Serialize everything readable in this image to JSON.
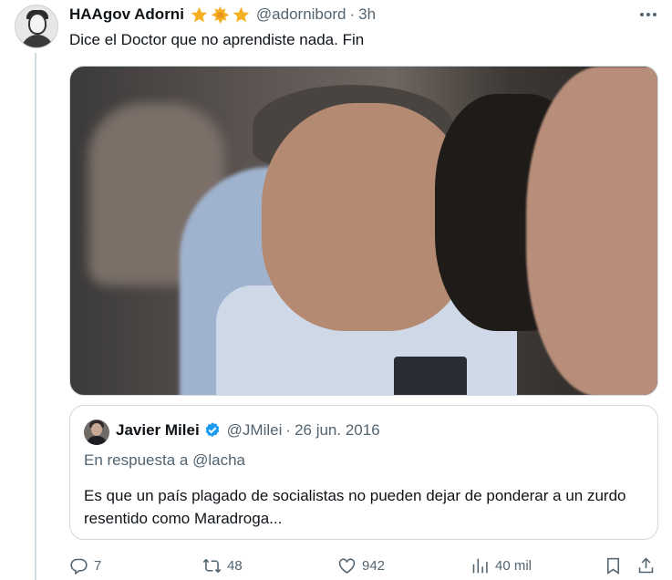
{
  "tweet": {
    "author_name": "HAAgov Adorni",
    "handle": "@adornibord",
    "separator": "·",
    "time": "3h",
    "text": "Dice el Doctor que no aprendiste nada. Fin",
    "badge_icons": [
      "star-icon",
      "star-icon",
      "star-icon"
    ]
  },
  "quote": {
    "author_name": "Javier Milei",
    "verified": true,
    "handle": "@JMilei",
    "separator": "·",
    "date": "26 jun. 2016",
    "reply_prefix": "En respuesta a",
    "reply_to": "@lacha",
    "text": "Es que un país plagado de socialistas no pueden dejar de ponderar a un zurdo resentido como Maradroga..."
  },
  "actions": {
    "replies": "7",
    "reposts": "48",
    "likes": "942",
    "views": "40 mil"
  },
  "colors": {
    "text_primary": "#0f1419",
    "text_secondary": "#536471",
    "border": "#cfd9de",
    "verified_blue": "#1d9bf0",
    "star_gold": "#f5b021"
  }
}
